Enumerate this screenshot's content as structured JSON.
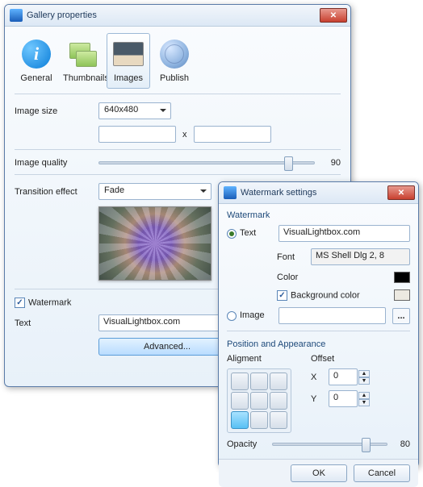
{
  "w1": {
    "title": "Gallery properties",
    "tabs": [
      "General",
      "Thumbnails",
      "Images",
      "Publish"
    ],
    "image_size_label": "Image size",
    "image_size_value": "640x480",
    "x_separator": "x",
    "image_quality_label": "Image quality",
    "image_quality_value": "90",
    "transition_label": "Transition effect",
    "transition_value": "Fade",
    "watermark_label": "Watermark",
    "text_label": "Text",
    "text_value": "VisualLightbox.com",
    "advanced_label": "Advanced..."
  },
  "w2": {
    "title": "Watermark settings",
    "group_label": "Watermark",
    "text_radio_label": "Text",
    "text_value": "VisualLightbox.com",
    "font_label": "Font",
    "font_value": "MS Shell Dlg 2, 8",
    "color_label": "Color",
    "color_value": "#000000",
    "bgcolor_label": "Background color",
    "image_radio_label": "Image",
    "pos_label": "Position and Appearance",
    "alignment_label": "Aligment",
    "offset_label": "Offset",
    "x_label": "X",
    "x_value": "0",
    "y_label": "Y",
    "y_value": "0",
    "opacity_label": "Opacity",
    "opacity_value": "80",
    "ok_label": "OK",
    "cancel_label": "Cancel",
    "browse_glyph": "..."
  }
}
